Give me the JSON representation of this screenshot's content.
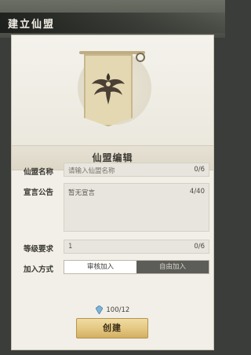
{
  "header": {
    "title": "建立仙盟"
  },
  "panel": {
    "section_title": "仙盟编辑",
    "name_row": {
      "label": "仙盟名称",
      "placeholder": "请输入仙盟名称",
      "count": "0/6"
    },
    "declaration_row": {
      "label": "宣言公告",
      "value": "暂无宣言",
      "count": "4/40"
    },
    "level_row": {
      "label": "等级要求",
      "value": "1",
      "count": "0/6"
    },
    "join_row": {
      "label": "加入方式",
      "options": [
        "审核加入",
        "自由加入"
      ],
      "selected": "审核加入"
    },
    "cost": {
      "value": "100/12",
      "icon": "gem-icon"
    },
    "create_button": "创建"
  },
  "colors": {
    "panel_bg": "#f1efe7",
    "button_gold": "#e2c47d",
    "toggle_dark": "#5c5c58"
  }
}
